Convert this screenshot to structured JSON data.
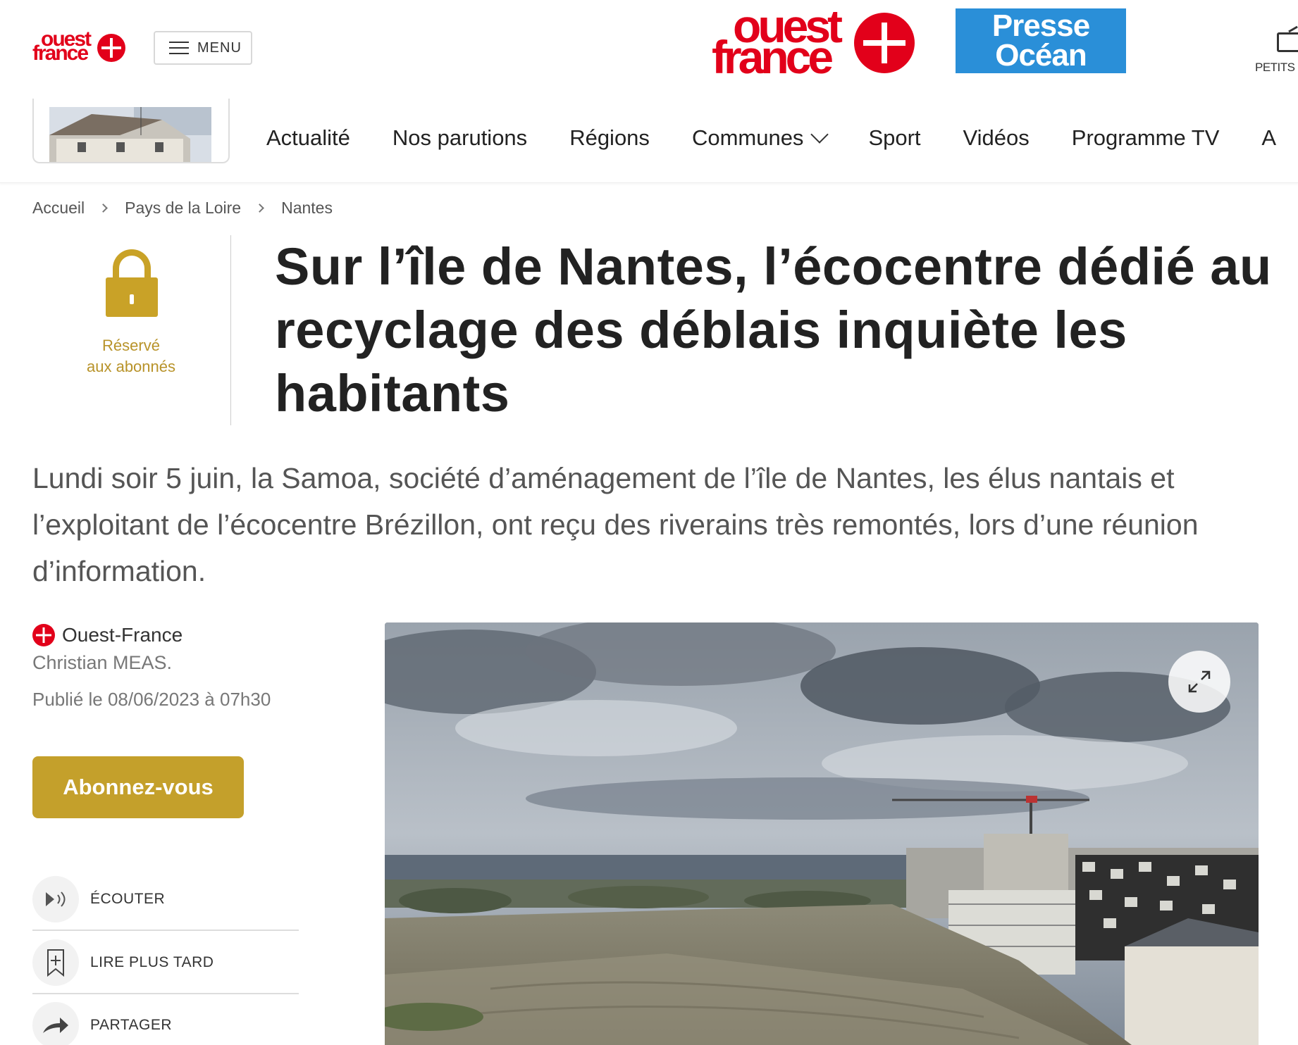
{
  "header": {
    "logo_small_line1": "ouest",
    "logo_small_line2": "france",
    "menu_label": "MENU",
    "logo_big_line1": "ouest",
    "logo_big_line2": "france",
    "partner_line1": "Presse",
    "partner_line2": "Océan",
    "petits_label": "PETITS ÉC"
  },
  "nav": {
    "items": [
      {
        "label": "Actualité"
      },
      {
        "label": "Nos parutions"
      },
      {
        "label": "Régions"
      },
      {
        "label": "Communes"
      },
      {
        "label": "Sport"
      },
      {
        "label": "Vidéos"
      },
      {
        "label": "Programme TV"
      },
      {
        "label": "A"
      }
    ]
  },
  "breadcrumb": [
    "Accueil",
    "Pays de la Loire",
    "Nantes"
  ],
  "badge": {
    "line1": "Réservé",
    "line2": "aux abonnés"
  },
  "article": {
    "title": "Sur l’île de Nantes, l’écocentre dédié au recyclage des déblais inquiète les habitants",
    "lead": "Lundi soir 5 juin, la Samoa, société d’aménagement de l’île de Nantes, les élus nantais et l’exploitant de l’écocentre Brézillon, ont reçu des riverains très remontés, lors d’une réunion d’information.",
    "source": "Ouest-France",
    "author": "Christian MEAS.",
    "date": "Publié le 08/06/2023 à 07h30"
  },
  "subscribe_label": "Abonnez-vous",
  "actions": [
    {
      "label": "ÉCOUTER",
      "icon": "speaker-icon"
    },
    {
      "label": "LIRE PLUS TARD",
      "icon": "bookmark-add-icon"
    },
    {
      "label": "PARTAGER",
      "icon": "share-arrow-icon"
    }
  ],
  "colors": {
    "brand_red": "#e2001a",
    "partner_blue": "#2a8fd8",
    "subscriber_gold": "#c4a02b"
  }
}
